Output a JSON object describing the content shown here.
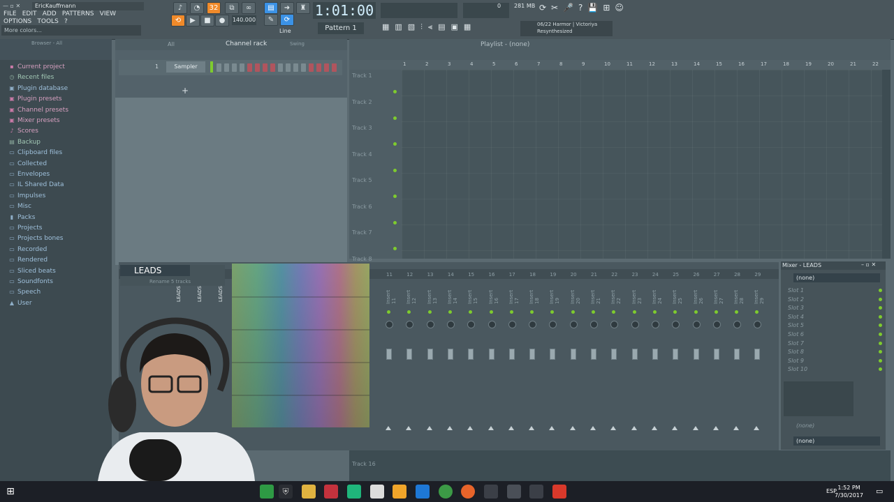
{
  "app": {
    "user_title": "EricKauffmann",
    "menu": [
      "FILE",
      "EDIT",
      "ADD",
      "PATTERNS",
      "VIEW",
      "OPTIONS",
      "TOOLS",
      "?"
    ],
    "hint": "More colors..."
  },
  "transport": {
    "time": "1:01:00",
    "tempo": "140.000",
    "pattern": "Pattern 1",
    "snap": "Line",
    "cpu": "0",
    "memory": "281 MB"
  },
  "hint_panel": {
    "line1": "06/22  Harmor | Victoriya",
    "line2": "Resynthesized"
  },
  "browser": {
    "title": "Browser - All",
    "items": [
      {
        "label": "Current project",
        "icon": "project-icon",
        "style": "pink"
      },
      {
        "label": "Recent files",
        "icon": "recent-icon",
        "style": "green"
      },
      {
        "label": "Plugin database",
        "icon": "plugin-db-icon",
        "style": "blue"
      },
      {
        "label": "Plugin presets",
        "icon": "plugin-presets-icon",
        "style": "pink"
      },
      {
        "label": "Channel presets",
        "icon": "channel-presets-icon",
        "style": "pink"
      },
      {
        "label": "Mixer presets",
        "icon": "mixer-presets-icon",
        "style": "pink"
      },
      {
        "label": "Scores",
        "icon": "note-icon",
        "style": "pink"
      },
      {
        "label": "Backup",
        "icon": "backup-icon",
        "style": "green"
      },
      {
        "label": "Clipboard files",
        "icon": "folder-icon",
        "style": "blue"
      },
      {
        "label": "Collected",
        "icon": "folder-icon",
        "style": "blue"
      },
      {
        "label": "Envelopes",
        "icon": "folder-icon",
        "style": "blue"
      },
      {
        "label": "IL Shared Data",
        "icon": "folder-icon",
        "style": "blue"
      },
      {
        "label": "Impulses",
        "icon": "folder-icon",
        "style": "blue"
      },
      {
        "label": "Misc",
        "icon": "folder-icon",
        "style": "blue"
      },
      {
        "label": "Packs",
        "icon": "packs-icon",
        "style": "blue"
      },
      {
        "label": "Projects",
        "icon": "folder-icon",
        "style": "blue"
      },
      {
        "label": "Projects bones",
        "icon": "folder-icon",
        "style": "blue"
      },
      {
        "label": "Recorded",
        "icon": "folder-icon",
        "style": "blue"
      },
      {
        "label": "Rendered",
        "icon": "folder-icon",
        "style": "blue"
      },
      {
        "label": "Sliced beats",
        "icon": "folder-icon",
        "style": "blue"
      },
      {
        "label": "Soundfonts",
        "icon": "folder-icon",
        "style": "blue"
      },
      {
        "label": "Speech",
        "icon": "folder-icon",
        "style": "blue"
      },
      {
        "label": "User",
        "icon": "user-icon",
        "style": "blue"
      }
    ]
  },
  "channel_rack": {
    "title": "Channel rack",
    "filter": "All",
    "swing": "Swing",
    "channel_number": "1",
    "channel_name": "Sampler"
  },
  "playlist": {
    "title": "Playlist - (none)",
    "ruler": [
      "1",
      "2",
      "3",
      "4",
      "5",
      "6",
      "7",
      "8",
      "9",
      "10",
      "11",
      "12",
      "13",
      "14",
      "15",
      "16",
      "17",
      "18",
      "19",
      "20",
      "21",
      "22"
    ],
    "tracks": [
      "Track 1",
      "Track 2",
      "Track 3",
      "Track 4",
      "Track 5",
      "Track 6",
      "Track 7",
      "Track 8"
    ],
    "bottom_track": "Track 16"
  },
  "mixer": {
    "title": "Mixer - LEADS",
    "rename_value": "LEADS",
    "rename_hint": "Rename 5 tracks",
    "lead_labels": [
      "LEADS",
      "LEADS",
      "LEADS"
    ],
    "insert_numbers": [
      "11",
      "12",
      "13",
      "14",
      "15",
      "16",
      "17",
      "18",
      "19",
      "20",
      "21",
      "22",
      "23",
      "24",
      "25",
      "26",
      "27",
      "28",
      "29"
    ],
    "inserts": [
      "Insert 11",
      "Insert 12",
      "Insert 13",
      "Insert 14",
      "Insert 15",
      "Insert 16",
      "Insert 17",
      "Insert 18",
      "Insert 19",
      "Insert 20",
      "Insert 21",
      "Insert 22",
      "Insert 23",
      "Insert 24",
      "Insert 25",
      "Insert 26",
      "Insert 27",
      "Insert 28",
      "Insert 29"
    ],
    "preset": "(none)",
    "slots": [
      "Slot 1",
      "Slot 2",
      "Slot 3",
      "Slot 4",
      "Slot 5",
      "Slot 6",
      "Slot 7",
      "Slot 8",
      "Slot 9",
      "Slot 10"
    ],
    "out_top": "(none)",
    "out_bottom": "(none)"
  },
  "taskbar": {
    "language": "ESP",
    "time": "1:52 PM",
    "date": "7/30/2017"
  },
  "colors": {
    "accent_orange": "#f08a2a",
    "accent_blue": "#3b92e6",
    "led_green": "#7ecb2e"
  }
}
